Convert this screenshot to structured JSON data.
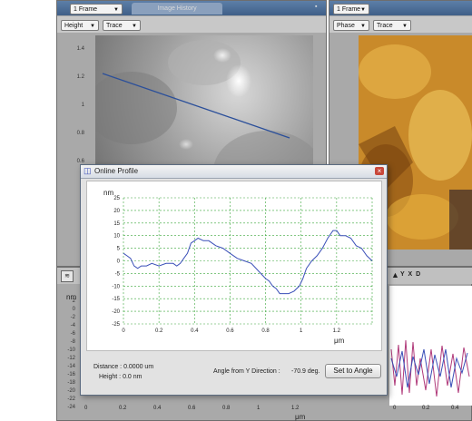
{
  "left_panel": {
    "frame_select": "1 Frame",
    "history_tab": "Image History",
    "channel_select": "Height",
    "direction_select": "Trace",
    "y_ticks": [
      "1.4",
      "1.2",
      "1",
      "0.8",
      "0.6"
    ]
  },
  "right_panel": {
    "frame_select": "1 Frame",
    "channel_select": "Phase",
    "direction_select": "Trace"
  },
  "bottom_panel": {
    "unit": "nm",
    "y_ticks": [
      "2",
      "0",
      "-2",
      "-4",
      "-6",
      "-8",
      "-10",
      "-12",
      "-14",
      "-16",
      "-18",
      "-20",
      "-22",
      "-24"
    ],
    "x_ticks": [
      "0",
      "0.2",
      "0.4",
      "0.6",
      "0.8",
      "1",
      "1.2"
    ],
    "x_unit": "μm",
    "right_x_ticks": [
      "0",
      "0.2",
      "0.4"
    ],
    "right_label": "Y X D"
  },
  "dialog": {
    "title": "Online Profile",
    "close_glyph": "×",
    "distance_label": "Distance : 0.0000 um",
    "height_label": "Height : 0.0 nm",
    "angle_label": "Angle from Y Direction :",
    "angle_value": "-70.9 deg.",
    "set_button": "Set to Angle"
  },
  "chart_data": {
    "type": "line",
    "ylabel": "nm",
    "xlabel": "μm",
    "xlim": [
      0,
      1.4
    ],
    "ylim": [
      -25,
      25
    ],
    "x_ticks": [
      "0",
      "0.2",
      "0.4",
      "0.6",
      "0.8",
      "1",
      "1.2"
    ],
    "y_ticks": [
      "25",
      "20",
      "15",
      "10",
      "5",
      "0",
      "-5",
      "-10",
      "-15",
      "-20",
      "-25"
    ],
    "grid": true,
    "series": [
      {
        "color": "#3a4fb8",
        "x": [
          0,
          0.02,
          0.04,
          0.06,
          0.08,
          0.1,
          0.13,
          0.16,
          0.2,
          0.24,
          0.28,
          0.3,
          0.32,
          0.34,
          0.36,
          0.38,
          0.4,
          0.42,
          0.45,
          0.48,
          0.52,
          0.56,
          0.6,
          0.64,
          0.68,
          0.72,
          0.76,
          0.8,
          0.82,
          0.84,
          0.86,
          0.88,
          0.9,
          0.93,
          0.96,
          0.99,
          1.01,
          1.03,
          1.06,
          1.09,
          1.12,
          1.15,
          1.18,
          1.2,
          1.22,
          1.25,
          1.28,
          1.31,
          1.34,
          1.37,
          1.4
        ],
        "y": [
          3,
          2,
          1,
          -2,
          -3,
          -2,
          -2,
          -1,
          -2,
          -1,
          -1,
          -2,
          -1,
          1,
          3,
          7,
          8,
          9,
          8,
          8,
          6,
          5,
          3,
          1,
          0,
          -1,
          -4,
          -7,
          -8,
          -10,
          -11,
          -13,
          -13,
          -13,
          -12,
          -10,
          -7,
          -3,
          0,
          2,
          5,
          9,
          12,
          12,
          10,
          10,
          9,
          6,
          5,
          2,
          0
        ]
      }
    ]
  }
}
